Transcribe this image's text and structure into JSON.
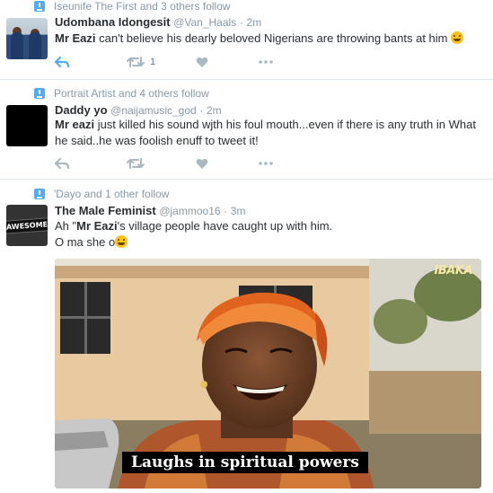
{
  "tweets": [
    {
      "context": "Iseunife The First and 3 others follow",
      "name": "Udombana Idongesit",
      "handle": "@Van_Haals",
      "separator": "·",
      "time": "2m",
      "text_bold": "Mr Eazi",
      "text_rest": " can't believe his dearly beloved Nigerians are throwing bants at him",
      "emoji": "face-with-tears-of-joy",
      "retweet_count": "1"
    },
    {
      "context": "Portrait Artist and 4 others follow",
      "name": "Daddy yo",
      "handle": "@naijamusic_god",
      "separator": "·",
      "time": "2m",
      "text_bold": "Mr eazi",
      "text_rest": " just killed his sound wjth his foul mouth...even if there is any truth in What he said..he was foolish enuff to tweet it!"
    },
    {
      "context": "'Dayo and 1 other follow",
      "name": "The Male Feminist",
      "handle": "@jammoo16",
      "separator": "·",
      "time": "3m",
      "text_pre": "Ah \"",
      "text_bold": "Mr Eazi",
      "text_rest": "'s village people have caught up with him.",
      "text_line2": "O ma she o",
      "emoji": "grinning-squinting-face",
      "avatar_label": "AWESOME",
      "media_caption": "Laughs in spiritual powers",
      "media_watermark": "IBAKA"
    }
  ],
  "colors": {
    "accent": "#55acee",
    "muted": "#8899a6",
    "icon": "#aab8c2",
    "text": "#292f33"
  }
}
